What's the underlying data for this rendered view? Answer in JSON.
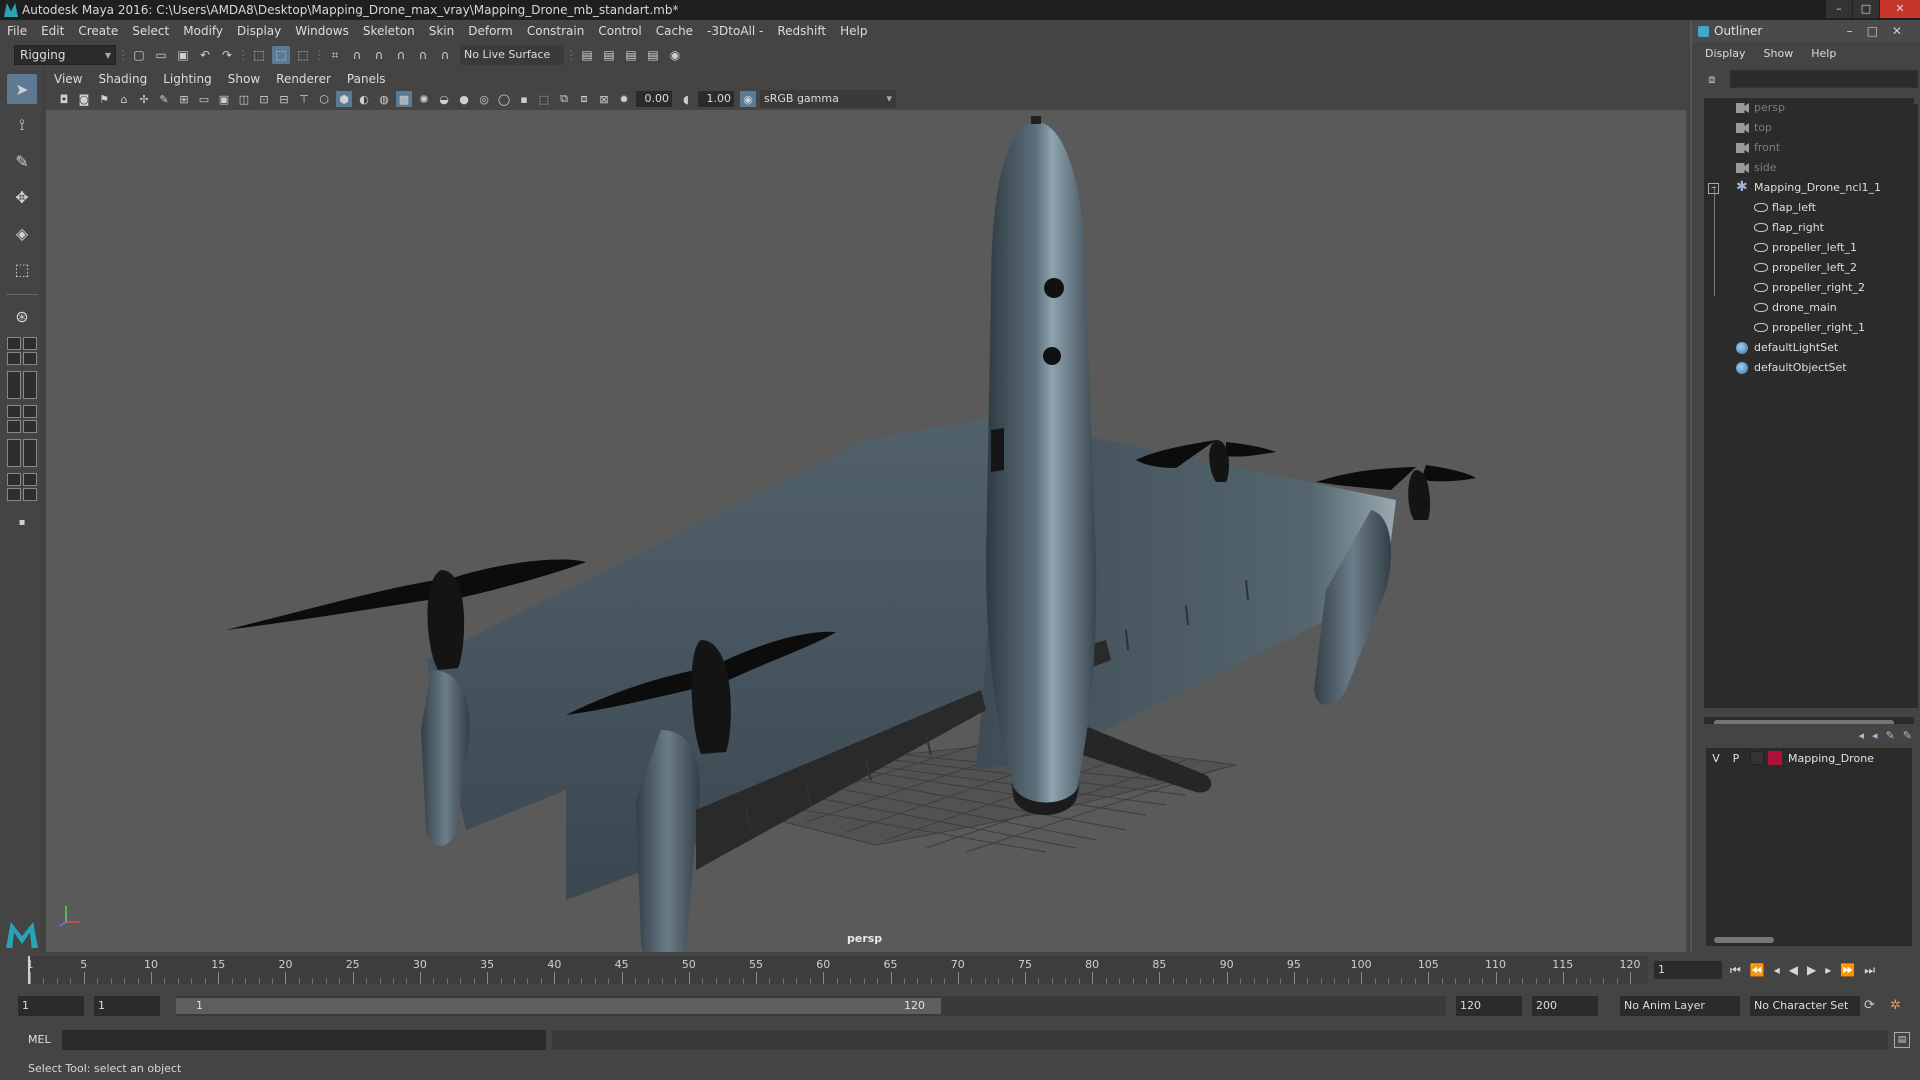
{
  "window": {
    "title": "Autodesk Maya 2016: C:\\Users\\AMDA8\\Desktop\\Mapping_Drone_max_vray\\Mapping_Drone_mb_standart.mb*"
  },
  "menubar": [
    "File",
    "Edit",
    "Create",
    "Select",
    "Modify",
    "Display",
    "Windows",
    "Skeleton",
    "Skin",
    "Deform",
    "Constrain",
    "Control",
    "Cache",
    "-3DtoAll -",
    "Redshift",
    "Help"
  ],
  "statusline": {
    "mode": "Rigging",
    "live_surface": "No Live Surface"
  },
  "panel": {
    "menu": [
      "View",
      "Shading",
      "Lighting",
      "Show",
      "Renderer",
      "Panels"
    ],
    "near_value": "0.00",
    "far_value": "1.00",
    "color_space": "sRGB gamma",
    "camera_label": "persp"
  },
  "outliner": {
    "title": "Outliner",
    "menu": [
      "Display",
      "Show",
      "Help"
    ],
    "items": [
      {
        "label": "persp",
        "icon": "camera-icon",
        "indent": 0,
        "dim": true
      },
      {
        "label": "top",
        "icon": "camera-icon",
        "indent": 0,
        "dim": true
      },
      {
        "label": "front",
        "icon": "camera-icon",
        "indent": 0,
        "dim": true
      },
      {
        "label": "side",
        "icon": "camera-icon",
        "indent": 0,
        "dim": true
      },
      {
        "label": "Mapping_Drone_ncl1_1",
        "icon": "group-icon",
        "indent": 0,
        "dim": false,
        "expanded": true
      },
      {
        "label": "flap_left",
        "icon": "mesh-icon",
        "indent": 1,
        "dim": false
      },
      {
        "label": "flap_right",
        "icon": "mesh-icon",
        "indent": 1,
        "dim": false
      },
      {
        "label": "propeller_left_1",
        "icon": "mesh-icon",
        "indent": 1,
        "dim": false
      },
      {
        "label": "propeller_left_2",
        "icon": "mesh-icon",
        "indent": 1,
        "dim": false
      },
      {
        "label": "propeller_right_2",
        "icon": "mesh-icon",
        "indent": 1,
        "dim": false
      },
      {
        "label": "drone_main",
        "icon": "mesh-icon",
        "indent": 1,
        "dim": false
      },
      {
        "label": "propeller_right_1",
        "icon": "mesh-icon",
        "indent": 1,
        "dim": false
      },
      {
        "label": "defaultLightSet",
        "icon": "set-icon",
        "indent": 0,
        "dim": false
      },
      {
        "label": "defaultObjectSet",
        "icon": "set-icon",
        "indent": 0,
        "dim": false
      }
    ]
  },
  "layers": {
    "rows": [
      {
        "v": "V",
        "p": "P",
        "name": "Mapping_Drone",
        "color": "#b0113a"
      }
    ]
  },
  "timeline": {
    "labels": [
      "1",
      "5",
      "10",
      "15",
      "20",
      "25",
      "30",
      "35",
      "40",
      "45",
      "50",
      "55",
      "60",
      "65",
      "70",
      "75",
      "80",
      "85",
      "90",
      "95",
      "100",
      "105",
      "110",
      "115",
      "120"
    ],
    "current_frame": "1"
  },
  "range": {
    "start": "1",
    "start_inner": "1",
    "slider_lo": "1",
    "slider_hi": "120",
    "end_inner": "120",
    "end": "200",
    "anim_layer": "No Anim Layer",
    "character_set": "No Character Set"
  },
  "cmdline": {
    "language": "MEL"
  },
  "helpline": {
    "text": "Select Tool: select an object"
  },
  "colors": {
    "viewport_bg": "#5a5a5a",
    "drone_body": "#44515b",
    "propeller": "#111111",
    "accent": "#5b7b93"
  }
}
